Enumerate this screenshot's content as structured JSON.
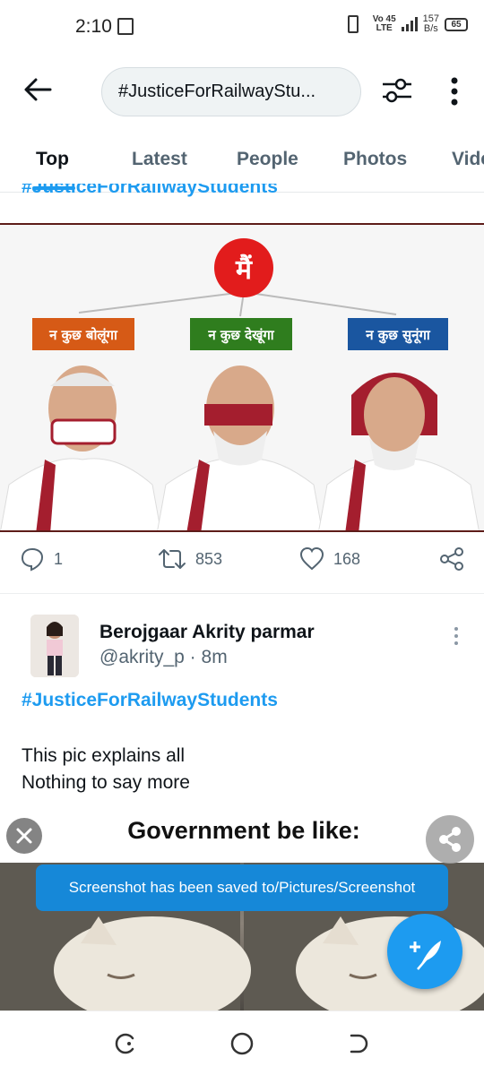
{
  "status_bar": {
    "time": "2:10",
    "network_top": "Vo",
    "network_mid": "45",
    "network_bottom": "LTE",
    "speed_value": "157",
    "speed_unit": "B/s",
    "battery": "65"
  },
  "header": {
    "search_text": "#JusticeForRailwayStu..."
  },
  "tabs": [
    {
      "label": "Top",
      "active": true
    },
    {
      "label": "Latest",
      "active": false
    },
    {
      "label": "People",
      "active": false
    },
    {
      "label": "Photos",
      "active": false
    },
    {
      "label": "Vide",
      "active": false
    }
  ],
  "tweet1": {
    "hashtag_cut": "#JusticeForRailwayStudents",
    "image": {
      "top_badge": "मैं",
      "labels": [
        "न कुछ बोलूंगा",
        "न कुछ देखूंगा",
        "न कुछ सुनूंगा"
      ]
    },
    "replies": "1",
    "retweets": "853",
    "likes": "168"
  },
  "tweet2": {
    "author_name": "Berojgaar Akrity parmar",
    "handle_time": "@akrity_p · 8m",
    "hashtag": "#JusticeForRailwayStudents",
    "text_line1": "This pic explains all",
    "text_line2": "Nothing to say more",
    "image_caption": "Government be like:"
  },
  "toast": {
    "message": "Screenshot has been saved to/Pictures/Screenshot"
  },
  "colors": {
    "accent": "#1d9bf0",
    "secondary_text": "#536471",
    "toast_bg": "#1688d8"
  }
}
